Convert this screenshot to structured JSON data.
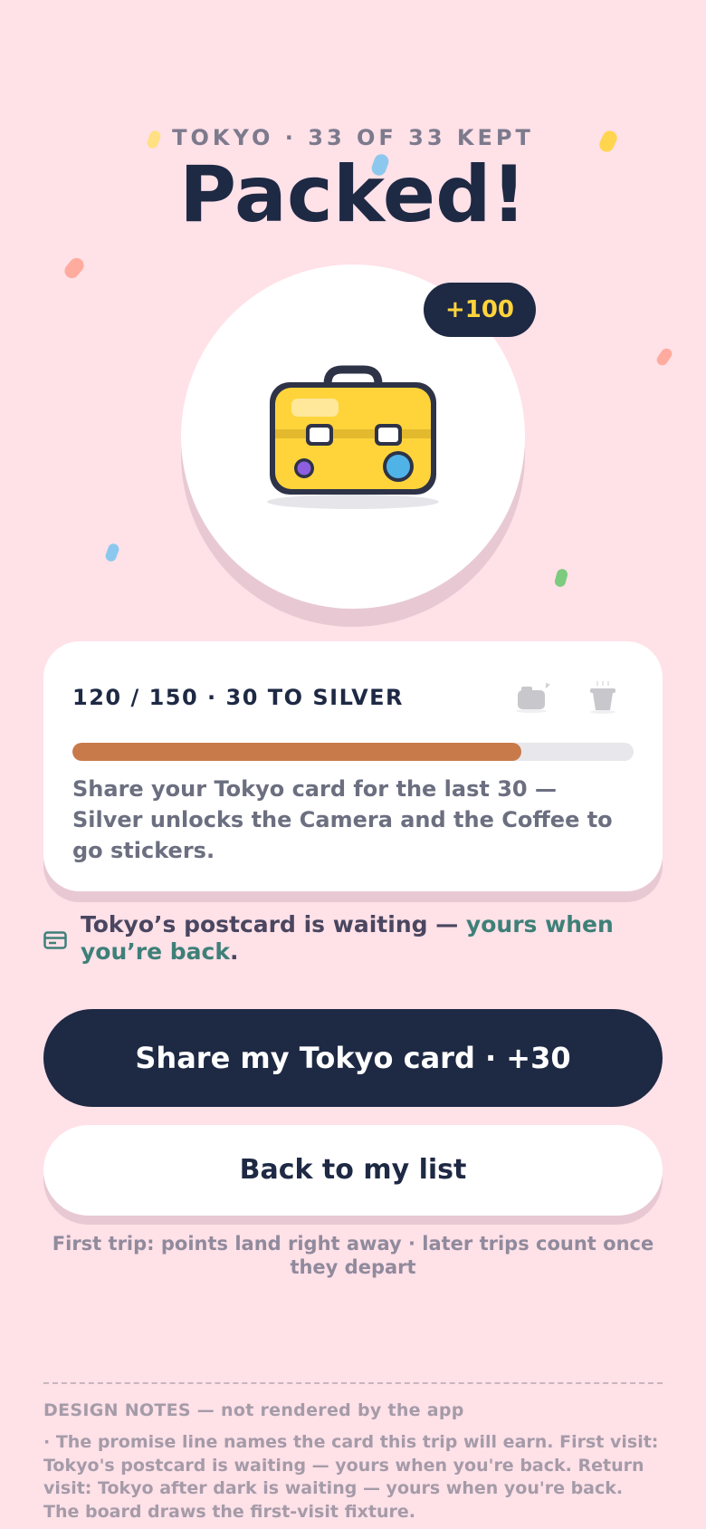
{
  "header": {
    "eyebrow": "TOKYO · 33 OF 33 KEPT",
    "title": "Packed!"
  },
  "hero": {
    "icon": "suitcase-icon",
    "points_badge": "+100"
  },
  "progress": {
    "label": "120 / 150 · 30 TO SILVER",
    "current": 120,
    "target": 150,
    "fill_fraction": 0.8,
    "description": "Share your Tokyo card for the last 30 — Silver unlocks the Camera and the Coffee to go stickers.",
    "reward_icons": [
      "camera-icon",
      "coffee-cup-icon"
    ]
  },
  "promise": {
    "icon": "postcard-icon",
    "text_lead": "Tokyo’s postcard is waiting — ",
    "text_accent": "yours when you’re back",
    "text_end": "."
  },
  "actions": {
    "primary_label": "Share my Tokyo card · +30",
    "secondary_label": "Back to my list"
  },
  "footnote": "First trip: points land right away · later trips count once they depart",
  "design_notes": {
    "heading": "DESIGN NOTES — not rendered by the app",
    "body": "· The promise line names the card this trip will earn. First visit: Tokyo's postcard is waiting — yours when you're back. Return visit: Tokyo after dark is waiting — yours when you're back. The board draws the first-visit fixture."
  },
  "colors": {
    "background": "#FFE1E8",
    "navy": "#1E2944",
    "accent_gold": "#FFD43B",
    "progress_fill": "#C97A4A",
    "accent_teal": "#3E8078"
  }
}
